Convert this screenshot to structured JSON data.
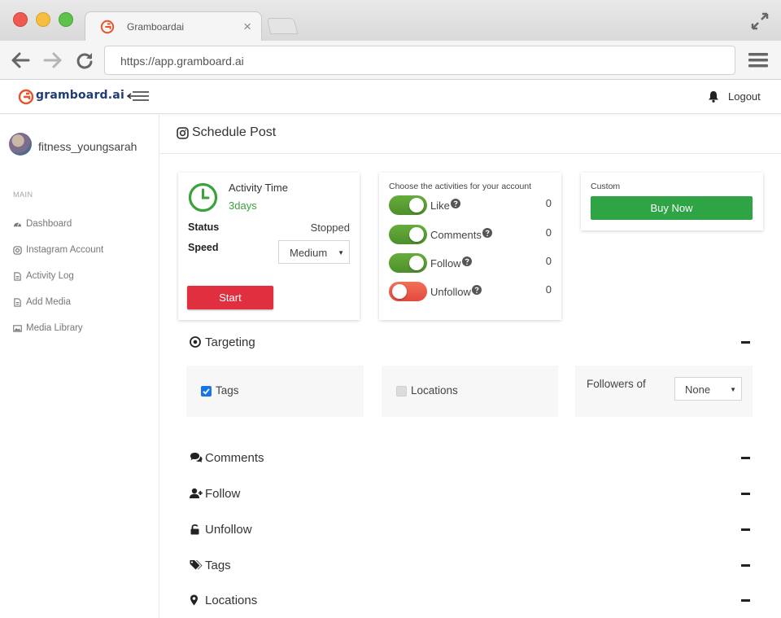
{
  "browser": {
    "tab_title": "Gramboardai",
    "tab_close": "×",
    "url": "https://app.gramboard.ai"
  },
  "header": {
    "brand": "gramboard.ai",
    "logout": "Logout"
  },
  "sidebar": {
    "username": "fitness_youngsarah",
    "section": "MAIN",
    "items": [
      {
        "label": "Dashboard",
        "icon": "dashboard-icon"
      },
      {
        "label": "Instagram Account",
        "icon": "instagram-icon"
      },
      {
        "label": "Activity Log",
        "icon": "file-icon"
      },
      {
        "label": "Add Media",
        "icon": "file-icon"
      },
      {
        "label": "Media Library",
        "icon": "images-icon"
      }
    ]
  },
  "main": {
    "title": "Schedule Post",
    "activity": {
      "title": "Activity Time",
      "days": "3days",
      "status_label": "Status",
      "status_value": "Stopped",
      "speed_label": "Speed",
      "speed_value": "Medium",
      "start_label": "Start"
    },
    "activities": {
      "title": "Choose the activities for your account",
      "rows": [
        {
          "label": "Like",
          "on": true,
          "count": "0"
        },
        {
          "label": "Comments",
          "on": true,
          "count": "0"
        },
        {
          "label": "Follow",
          "on": true,
          "count": "0"
        },
        {
          "label": "Unfollow",
          "on": false,
          "count": "0"
        }
      ]
    },
    "custom": {
      "label": "Custom",
      "buy_label": "Buy Now"
    },
    "targeting": {
      "title": "Targeting",
      "tags_label": "Tags",
      "tags_checked": true,
      "locations_label": "Locations",
      "locations_checked": false,
      "followers_label": "Followers of",
      "followers_value": "None"
    },
    "sections": [
      {
        "label": "Comments",
        "icon": "comments-icon"
      },
      {
        "label": "Follow",
        "icon": "user-plus-icon"
      },
      {
        "label": "Unfollow",
        "icon": "unlock-icon"
      },
      {
        "label": "Tags",
        "icon": "tags-icon"
      },
      {
        "label": "Locations",
        "icon": "map-marker-icon"
      }
    ]
  },
  "colors": {
    "brand_orange": "#e8542a",
    "brand_navy": "#1f3c74",
    "start_red": "#e0303f",
    "buy_green": "#2ea444",
    "toggle_on": "#5aa034",
    "toggle_off": "#e8503f",
    "accent_green_text": "#3aa23a"
  }
}
